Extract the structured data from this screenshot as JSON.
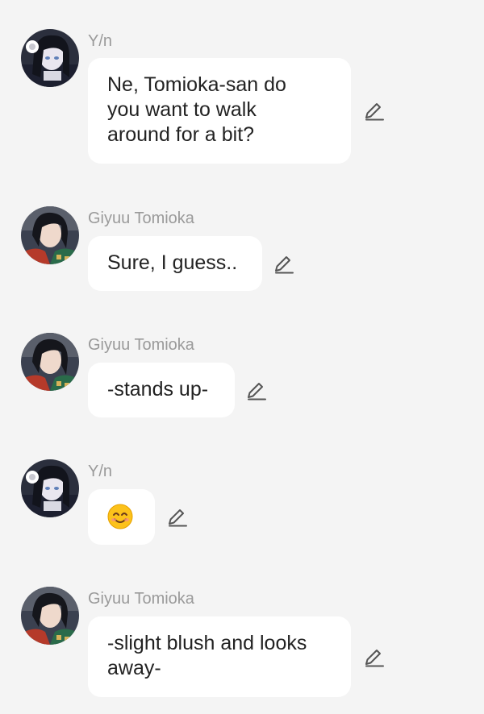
{
  "messages": [
    {
      "sender": "Y/n",
      "avatar": "yn-avatar",
      "text": "Ne, Tomioka-san do\nyou want to walk\naround for a bit?",
      "edit_icon": "pencil-edit-icon"
    },
    {
      "sender": "Giyuu Tomioka",
      "avatar": "giyuu-avatar",
      "text": "Sure, I guess..",
      "edit_icon": "pencil-edit-icon"
    },
    {
      "sender": "Giyuu Tomioka",
      "avatar": "giyuu-avatar",
      "text": "-stands up-",
      "edit_icon": "pencil-edit-icon"
    },
    {
      "sender": "Y/n",
      "avatar": "yn-avatar",
      "text": "",
      "emoji": "smiling-face-emoji",
      "edit_icon": "pencil-edit-icon"
    },
    {
      "sender": "Giyuu Tomioka",
      "avatar": "giyuu-avatar",
      "text": "-slight blush and looks\naway-",
      "edit_icon": "pencil-edit-icon"
    }
  ],
  "colors": {
    "background": "#f4f4f4",
    "bubble": "#ffffff",
    "sender_text": "#9a9a9a",
    "message_text": "#222222",
    "icon": "#555555"
  }
}
